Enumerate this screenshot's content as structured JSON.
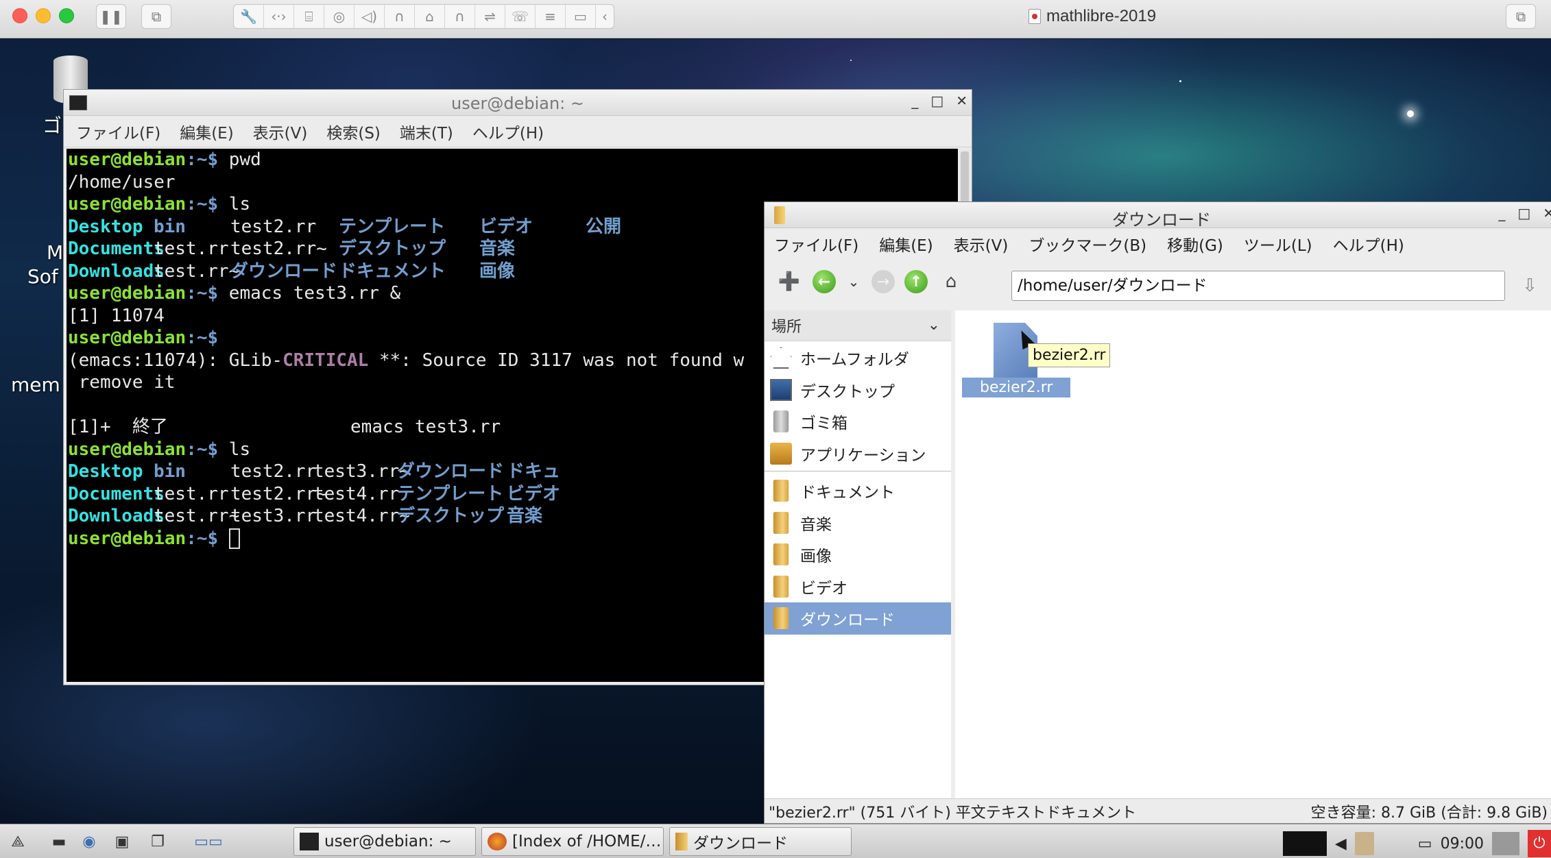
{
  "host": {
    "title": "mathlibre-2019",
    "toolbar_icons": [
      "pause-icon",
      "snapshot-icon",
      "wrench-icon",
      "network-icon",
      "drive-icon",
      "camera-icon",
      "audio-icon",
      "headphone-icon",
      "mouse-icon",
      "headset-icon",
      "usb-icon",
      "modem-icon",
      "storage-icon",
      "shared-folder-icon",
      "chevron-left-icon"
    ]
  },
  "desktop": {
    "icon_labels": [
      "ゴ",
      "M",
      "Sof",
      "mem"
    ]
  },
  "terminal": {
    "title": "user@debian: ~",
    "menu": [
      "ファイル(F)",
      "編集(E)",
      "表示(V)",
      "検索(S)",
      "端末(T)",
      "ヘルプ(H)"
    ],
    "prompt_user": "user@debian",
    "prompt_path": ":~$",
    "lines": [
      {
        "kind": "prompt",
        "cmd": " pwd"
      },
      {
        "kind": "out",
        "text": "/home/user"
      },
      {
        "kind": "prompt",
        "cmd": " ls"
      },
      {
        "kind": "ls",
        "cols": [
          [
            "Desktop",
            "cyan"
          ],
          [
            "bin",
            "blue"
          ],
          [
            "test2.rr",
            "plain"
          ],
          [
            "テンプレート",
            "blue"
          ],
          [
            "ビデオ",
            "blue"
          ],
          [
            "公開",
            "blue"
          ]
        ]
      },
      {
        "kind": "ls",
        "cols": [
          [
            "Documents",
            "cyan"
          ],
          [
            "test.rr",
            "plain"
          ],
          [
            "test2.rr~",
            "plain"
          ],
          [
            "デスクトップ",
            "blue"
          ],
          [
            "音楽",
            "blue"
          ]
        ]
      },
      {
        "kind": "ls",
        "cols": [
          [
            "Downloads",
            "cyan"
          ],
          [
            "test.rr~",
            "plain"
          ],
          [
            "ダウンロード",
            "blue"
          ],
          [
            "ドキュメント",
            "blue"
          ],
          [
            "画像",
            "blue"
          ]
        ]
      },
      {
        "kind": "prompt",
        "cmd": " emacs test3.rr &"
      },
      {
        "kind": "out",
        "text": "[1] 11074"
      },
      {
        "kind": "prompt",
        "cmd": ""
      },
      {
        "kind": "crit",
        "pre": "(emacs:11074): GLib-",
        "crit": "CRITICAL",
        "post": " **: Source ID 3117 was not found w"
      },
      {
        "kind": "out",
        "text": " remove it"
      },
      {
        "kind": "out",
        "text": ""
      },
      {
        "kind": "out",
        "text": "[1]+  終了                 emacs test3.rr"
      },
      {
        "kind": "prompt",
        "cmd": " ls"
      },
      {
        "kind": "ls",
        "cols": [
          [
            "Desktop",
            "cyan"
          ],
          [
            "bin",
            "blue"
          ],
          [
            "test2.rr",
            "plain"
          ],
          [
            "test3.rr~",
            "plain"
          ],
          [
            "ダウンロード",
            "blue"
          ],
          [
            "ドキュ",
            "blue"
          ]
        ]
      },
      {
        "kind": "ls",
        "cols": [
          [
            "Documents",
            "cyan"
          ],
          [
            "test.rr",
            "plain"
          ],
          [
            "test2.rr~",
            "plain"
          ],
          [
            "test4.rr",
            "plain"
          ],
          [
            "テンプレート",
            "blue"
          ],
          [
            "ビデオ",
            "blue"
          ]
        ]
      },
      {
        "kind": "ls",
        "cols": [
          [
            "Downloads",
            "cyan"
          ],
          [
            "test.rr~",
            "plain"
          ],
          [
            "test3.rr",
            "plain"
          ],
          [
            "test4.rr~",
            "plain"
          ],
          [
            "デスクトップ",
            "blue"
          ],
          [
            "音楽",
            "blue"
          ]
        ]
      },
      {
        "kind": "cursor",
        "cmd": " "
      }
    ]
  },
  "filemanager": {
    "title": "ダウンロード",
    "menu": [
      "ファイル(F)",
      "編集(E)",
      "表示(V)",
      "ブックマーク(B)",
      "移動(G)",
      "ツール(L)",
      "ヘルプ(H)"
    ],
    "path": "/home/user/ダウンロード",
    "sidebar_header": "場所",
    "places": [
      {
        "label": "ホームフォルダ",
        "icon": "home-icon"
      },
      {
        "label": "デスクトップ",
        "icon": "desktop-icon"
      },
      {
        "label": "ゴミ箱",
        "icon": "trash-icon"
      },
      {
        "label": "アプリケーション",
        "icon": "applications-icon"
      }
    ],
    "bookmarks": [
      {
        "label": "ドキュメント",
        "icon": "folder-icon",
        "selected": false
      },
      {
        "label": "音楽",
        "icon": "folder-icon",
        "selected": false
      },
      {
        "label": "画像",
        "icon": "folder-icon",
        "selected": false
      },
      {
        "label": "ビデオ",
        "icon": "folder-icon",
        "selected": false
      },
      {
        "label": "ダウンロード",
        "icon": "folder-icon",
        "selected": true
      }
    ],
    "file": {
      "name": "bezier2.rr",
      "tooltip": "bezier2.rr"
    },
    "status_left": "\"bezier2.rr\" (751 バイト) 平文テキストドキュメント",
    "status_right": "空き容量: 8.7 GiB (合計: 9.8 GiB)"
  },
  "taskbar": {
    "tasks": [
      {
        "label": "user@debian: ~",
        "icon": "terminal-icon"
      },
      {
        "label": "[Index of /HOME/…",
        "icon": "firefox-icon"
      },
      {
        "label": "ダウンロード",
        "icon": "folder-icon"
      }
    ],
    "clock": "09:00"
  }
}
